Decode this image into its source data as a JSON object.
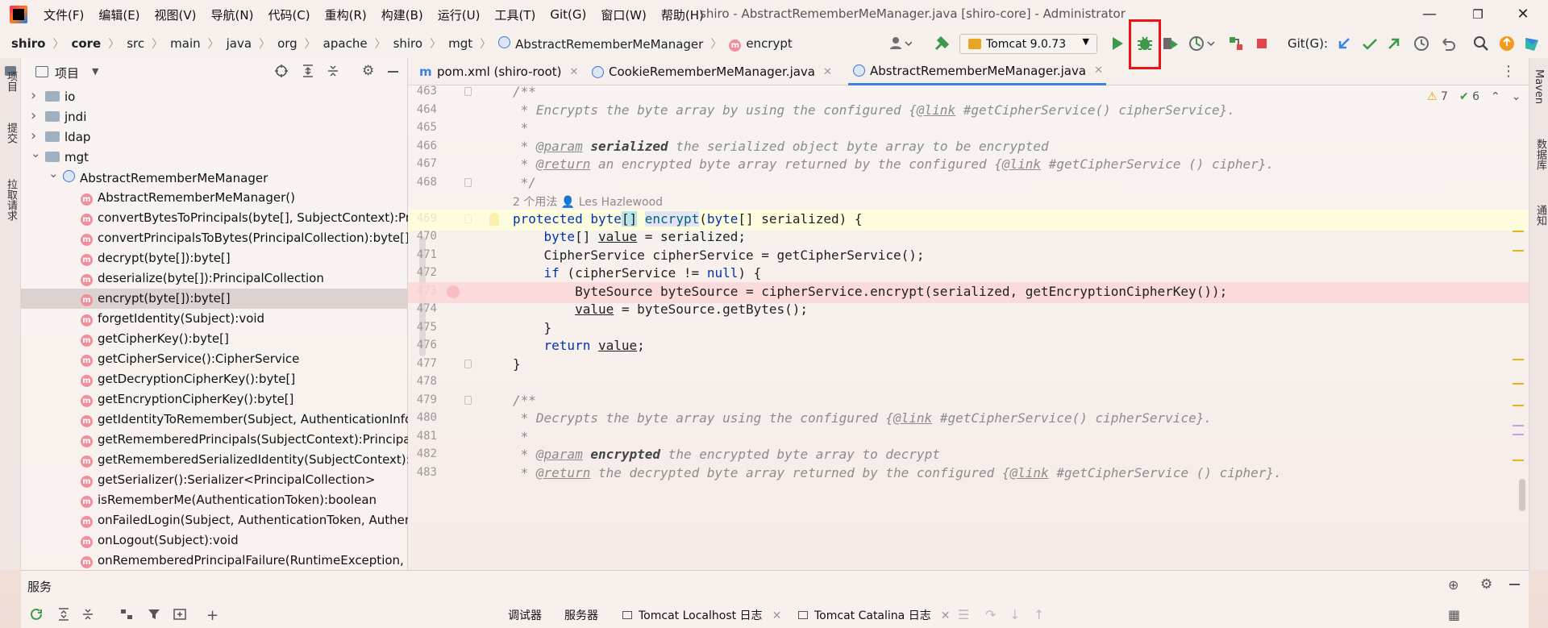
{
  "window": {
    "title": "shiro - AbstractRememberMeManager.java [shiro-core] - Administrator",
    "menu": [
      "文件(F)",
      "编辑(E)",
      "视图(V)",
      "导航(N)",
      "代码(C)",
      "重构(R)",
      "构建(B)",
      "运行(U)",
      "工具(T)",
      "Git(G)",
      "窗口(W)",
      "帮助(H)"
    ],
    "controls": {
      "minimize": "—",
      "maximize": "❐",
      "close": "✕"
    }
  },
  "breadcrumb": [
    "shiro",
    "core",
    "src",
    "main",
    "java",
    "org",
    "apache",
    "shiro",
    "mgt",
    "AbstractRememberMeManager",
    "encrypt"
  ],
  "toolbar": {
    "run_config": "Tomcat 9.0.73",
    "git_label": "Git(G):",
    "highlighted_button": "debug",
    "colors": {
      "run": "#3d9a4a",
      "stop": "#e0474c",
      "highlight": "#e8141a",
      "accent": "#3b82e6"
    }
  },
  "left_strip": {
    "tabs": [
      "项目",
      "提交",
      "拉取请求"
    ]
  },
  "project_panel": {
    "title": "项目",
    "rows": [
      {
        "label": "io",
        "kind": "folder",
        "expanded": false,
        "depth": 0
      },
      {
        "label": "jndi",
        "kind": "folder",
        "expanded": false,
        "depth": 0
      },
      {
        "label": "ldap",
        "kind": "folder",
        "expanded": false,
        "depth": 0
      },
      {
        "label": "mgt",
        "kind": "folder",
        "expanded": true,
        "depth": 0
      },
      {
        "label": "AbstractRememberMeManager",
        "kind": "class",
        "expanded": true,
        "depth": 1
      },
      {
        "label": "AbstractRememberMeManager()",
        "kind": "method",
        "depth": 2
      },
      {
        "label": "convertBytesToPrincipals(byte[], SubjectContext):Pri",
        "kind": "method",
        "depth": 2
      },
      {
        "label": "convertPrincipalsToBytes(PrincipalCollection):byte[]",
        "kind": "method",
        "depth": 2
      },
      {
        "label": "decrypt(byte[]):byte[]",
        "kind": "method",
        "depth": 2
      },
      {
        "label": "deserialize(byte[]):PrincipalCollection",
        "kind": "method",
        "depth": 2
      },
      {
        "label": "encrypt(byte[]):byte[]",
        "kind": "method",
        "depth": 2,
        "selected": true
      },
      {
        "label": "forgetIdentity(Subject):void",
        "kind": "method",
        "depth": 2
      },
      {
        "label": "getCipherKey():byte[]",
        "kind": "method",
        "depth": 2
      },
      {
        "label": "getCipherService():CipherService",
        "kind": "method",
        "depth": 2
      },
      {
        "label": "getDecryptionCipherKey():byte[]",
        "kind": "method",
        "depth": 2
      },
      {
        "label": "getEncryptionCipherKey():byte[]",
        "kind": "method",
        "depth": 2
      },
      {
        "label": "getIdentityToRemember(Subject, AuthenticationInfo",
        "kind": "method",
        "depth": 2
      },
      {
        "label": "getRememberedPrincipals(SubjectContext):Principa",
        "kind": "method",
        "depth": 2
      },
      {
        "label": "getRememberedSerializedIdentity(SubjectContext):l",
        "kind": "method",
        "depth": 2
      },
      {
        "label": "getSerializer():Serializer<PrincipalCollection>",
        "kind": "method",
        "depth": 2
      },
      {
        "label": "isRememberMe(AuthenticationToken):boolean",
        "kind": "method",
        "depth": 2
      },
      {
        "label": "onFailedLogin(Subject, AuthenticationToken, Authen",
        "kind": "method",
        "depth": 2
      },
      {
        "label": "onLogout(Subject):void",
        "kind": "method",
        "depth": 2
      },
      {
        "label": "onRememberedPrincipalFailure(RuntimeException, S",
        "kind": "method",
        "depth": 2
      }
    ]
  },
  "editor_tabs": [
    {
      "label": "pom.xml (shiro-root)",
      "icon": "maven-icon",
      "active": false
    },
    {
      "label": "CookieRememberMeManager.java",
      "icon": "class-icon",
      "active": false
    },
    {
      "label": "AbstractRememberMeManager.java",
      "icon": "class-icon",
      "active": true
    }
  ],
  "inspections": {
    "warnings": "7",
    "weak_warnings": "6"
  },
  "code_lines": [
    {
      "n": "463",
      "html": "<span class='cmt'>/**</span>"
    },
    {
      "n": "464",
      "html": "<span class='cmt'> * Encrypts the byte array by using the configured {</span><span class='tag'>@link</span><span class='cmt'> #getCipherService() cipherService}.</span>"
    },
    {
      "n": "465",
      "html": "<span class='cmt'> *</span>"
    },
    {
      "n": "466",
      "html": "<span class='cmt'> * </span><span class='tag'>@param</span><span class='cmt'> <b style='color:#444'>serialized</b> the serialized object byte array to be encrypted</span>"
    },
    {
      "n": "467",
      "html": "<span class='cmt'> * </span><span class='tag'>@return</span><span class='cmt'> an encrypted byte array returned by the configured {</span><span class='tag'>@link</span><span class='cmt'> #getCipherService () cipher}.</span>"
    },
    {
      "n": "468",
      "html": "<span class='cmt'> */</span>"
    },
    {
      "n": "",
      "inlay": "2 个用法   👤 Les Hazlewood"
    },
    {
      "n": "469",
      "html": "<span class='kw'>protected</span> <span class='kw'>byte</span><span style='background:#b9e3ea'>[]</span> <span class='fn' style='background:#e2e4f5'>encrypt</span>(<span class='kw'>byte</span>[] serialized) {",
      "hl": "current"
    },
    {
      "n": "470",
      "html": "    <span class='kw'>byte</span>[] <u>value</u> = serialized;"
    },
    {
      "n": "471",
      "html": "    CipherService cipherService = getCipherService();"
    },
    {
      "n": "472",
      "html": "    <span class='kw'>if</span> (cipherService != <span class='kw'>null</span>) {"
    },
    {
      "n": "473",
      "html": "        ByteSource byteSource = cipherService.encrypt(serialized, getEncryptionCipherKey());",
      "hl": "breakpoint"
    },
    {
      "n": "474",
      "html": "        <u>value</u> = byteSource.getBytes();"
    },
    {
      "n": "475",
      "html": "    }"
    },
    {
      "n": "476",
      "html": "    <span class='kw'>return</span> <u>value</u>;"
    },
    {
      "n": "477",
      "html": "}"
    },
    {
      "n": "478",
      "html": ""
    },
    {
      "n": "479",
      "html": "<span class='cmt'>/**</span>"
    },
    {
      "n": "480",
      "html": "<span class='cmt'> * Decrypts the byte array using the configured {</span><span class='tag'>@link</span><span class='cmt'> #getCipherService() cipherService}.</span>"
    },
    {
      "n": "481",
      "html": "<span class='cmt'> *</span>"
    },
    {
      "n": "482",
      "html": "<span class='cmt'> * </span><span class='tag'>@param</span><span class='cmt'> <b style='color:#444'>encrypted</b> the encrypted byte array to decrypt</span>"
    },
    {
      "n": "483",
      "html": "<span class='cmt'> * </span><span class='tag'>@return</span><span class='cmt'> the decrypted byte array returned by the configured {</span><span class='tag'>@link</span><span class='cmt'> #getCipherService () cipher}.</span>"
    }
  ],
  "right_strip": {
    "tabs": [
      "Maven",
      "数据库",
      "通知"
    ]
  },
  "services": {
    "title": "服务",
    "bottom_tabs": [
      "调试器",
      "服务器",
      "Tomcat Localhost 日志",
      "Tomcat Catalina 日志"
    ]
  }
}
